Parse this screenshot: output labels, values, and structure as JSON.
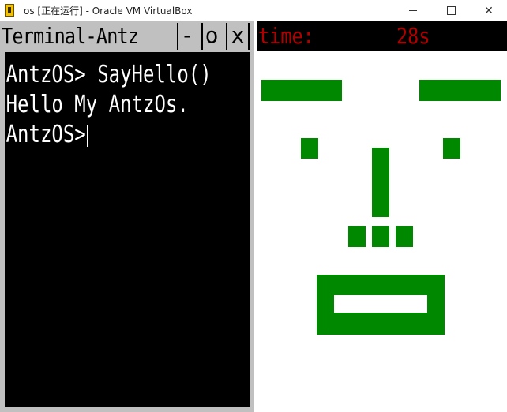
{
  "window": {
    "title": "os [正在运行] - Oracle VM VirtualBox",
    "icon": "virtualbox-app-icon",
    "controls": [
      "minimize",
      "maximize",
      "close"
    ],
    "close_glyph": "✕"
  },
  "terminal": {
    "title": "Terminal-Antz",
    "buttons": {
      "minimize": "-",
      "maximize": "o",
      "close": "x"
    },
    "lines": [
      "AntzOS> SayHello()",
      "Hello My AntzOs.",
      "AntzOS>"
    ]
  },
  "timer": {
    "label": "time:",
    "value": "28s"
  },
  "colors": {
    "face": "#008800",
    "timer_text": "#b00000",
    "terminal_bg": "#000000",
    "terminal_text": "#ffffff",
    "frame": "#c0c0c0"
  }
}
